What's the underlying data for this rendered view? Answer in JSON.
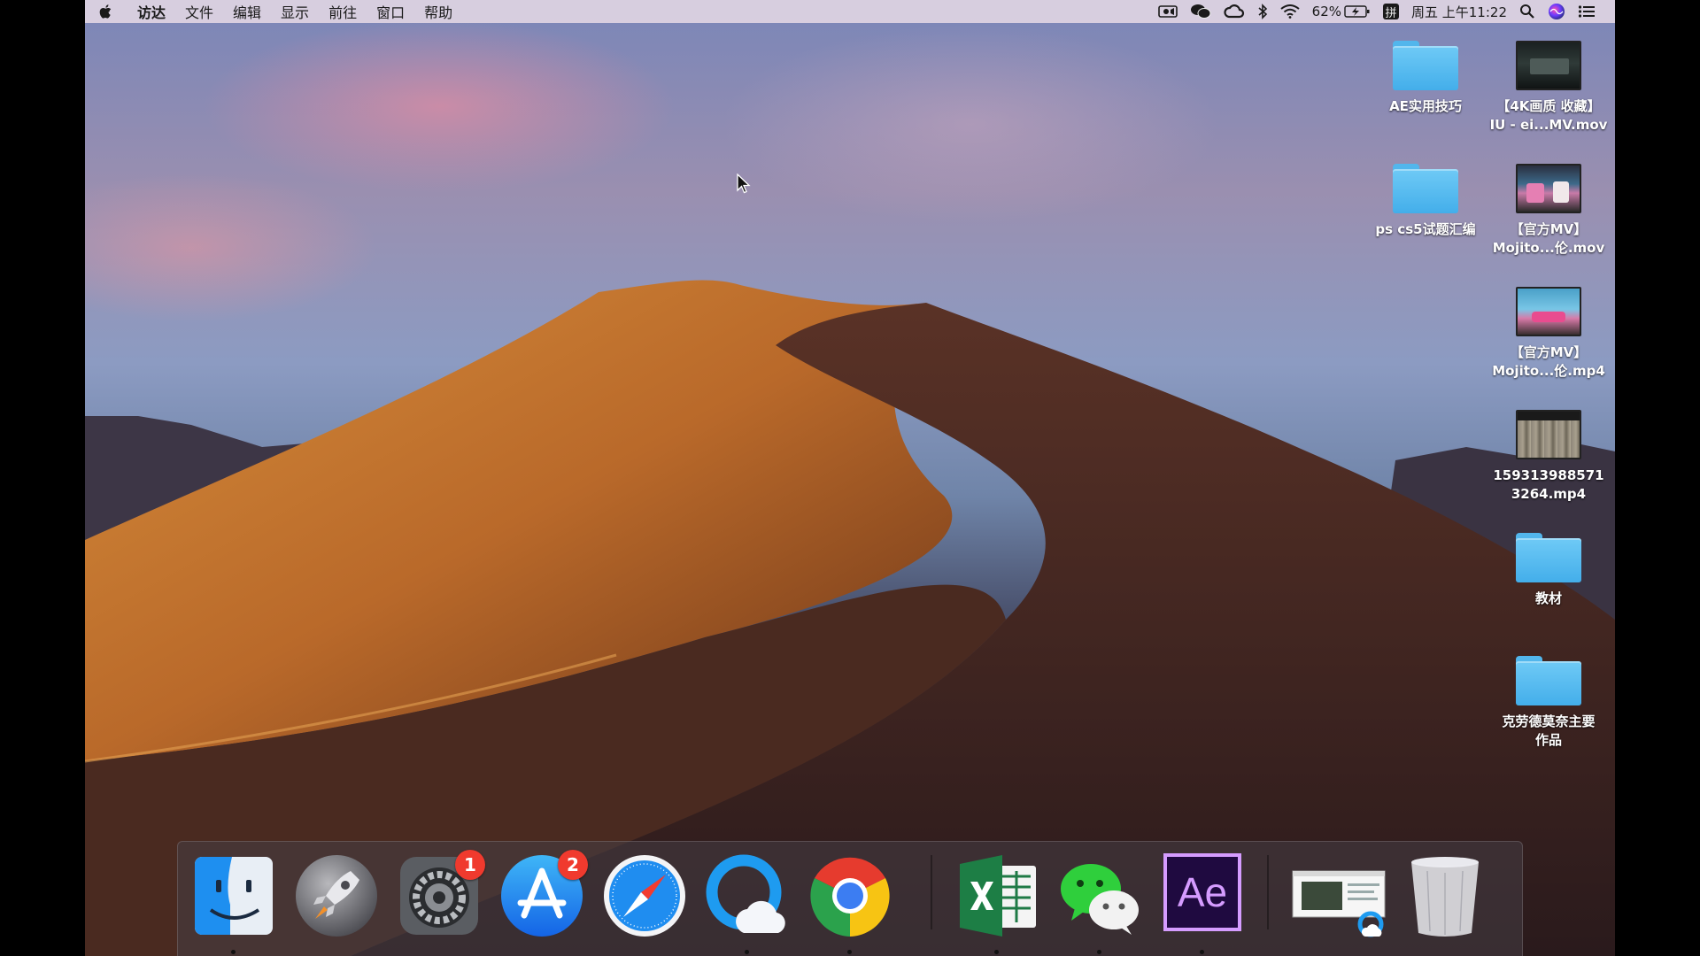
{
  "menubar": {
    "app_name": "访达",
    "items": [
      "文件",
      "编辑",
      "显示",
      "前往",
      "窗口",
      "帮助"
    ],
    "battery_percent": "62%",
    "input_method": "拼",
    "datetime": "周五 上午11:22"
  },
  "desktop": {
    "items": [
      {
        "name": "AE实用技巧",
        "kind": "folder"
      },
      {
        "line1": "【4K画质 收藏】",
        "line2": "IU - ei...MV.mov",
        "kind": "video"
      },
      {
        "name": "ps cs5试题汇编",
        "kind": "folder"
      },
      {
        "line1": "【官方MV】",
        "line2": "Mojito...伦.mov",
        "kind": "video"
      },
      {
        "line1": "【官方MV】",
        "line2": "Mojito...伦.mp4",
        "kind": "video"
      },
      {
        "line1": "159313988571",
        "line2": "3264.mp4",
        "kind": "video"
      },
      {
        "name": "教材",
        "kind": "folder"
      },
      {
        "line1": "克劳德莫奈主要",
        "line2": "作品",
        "kind": "folder"
      }
    ]
  },
  "dock": {
    "apps": [
      {
        "id": "finder",
        "running": true
      },
      {
        "id": "launchpad",
        "running": false
      },
      {
        "id": "system-preferences",
        "running": false,
        "badge": "1"
      },
      {
        "id": "app-store",
        "running": false,
        "badge": "2"
      },
      {
        "id": "safari",
        "running": false
      },
      {
        "id": "baidu-netdisk",
        "running": true
      },
      {
        "id": "chrome",
        "running": true
      },
      {
        "id": "excel",
        "running": true
      },
      {
        "id": "wechat",
        "running": true
      },
      {
        "id": "after-effects",
        "running": true,
        "label": "Ae"
      },
      {
        "id": "preview-window",
        "running": false
      },
      {
        "id": "trash",
        "running": false
      }
    ]
  },
  "colors": {
    "folder_blue": "#4fb4ec",
    "badge_red": "#f03a2e",
    "ae_purple": "#1f0a40",
    "ae_text": "#d59cff"
  }
}
